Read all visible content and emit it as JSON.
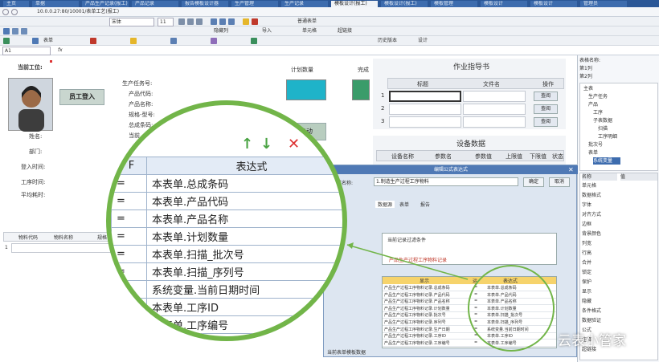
{
  "tabs": [
    "主页",
    "单据",
    "产品生产记录(报工)",
    "产品记录",
    "报告模板设计器",
    "生产管理",
    "生产记录",
    "模板设计(报工)",
    "模板设计(报工)",
    "模板管理",
    "模板设计",
    "模板设计",
    "管理员"
  ],
  "address": "10.0.0.27:80/10001/表单工艺(报工)",
  "toolbar": {
    "font": "宋体",
    "font_size": "11",
    "style_label": "普通表单",
    "btn_hide_col": "隐藏列",
    "btn_import": "导入",
    "btn_cell": "单元格",
    "btn_link": "超链接",
    "btn_form": "表单",
    "btn_history": "历史版本",
    "btn_design": "设计"
  },
  "formula_bar": {
    "cell_ref": "A1",
    "value": ""
  },
  "sheet": {
    "work_order_label": "当前工位:",
    "operator_btn": "员工登入",
    "plan_qty_title": "计划数量",
    "complete_title": "完成",
    "instruction_title": "作业指导书",
    "instruction_headers": [
      "标题",
      "文件名",
      "操作"
    ],
    "instruction_rows": [
      {
        "no": "1",
        "action": "查阅"
      },
      {
        "no": "2",
        "action": "查阅"
      },
      {
        "no": "3",
        "action": "查阅"
      }
    ],
    "equipment_title": "设备数据",
    "equipment_headers": [
      "设备名称",
      "参数名",
      "参数值",
      "上限值",
      "下限值",
      "状态"
    ],
    "fields_mid": [
      "生产任务号:",
      "产品代码:",
      "产品名称:",
      "规格-型号:",
      "总成条码:",
      "当前"
    ],
    "fields_left": [
      "姓名:",
      "部门:",
      "登入时间:",
      "工序时间:",
      "平均耗时:"
    ],
    "start_btn": "启动",
    "bottom_headers": [
      "物料代码",
      "物料名称",
      "规格"
    ],
    "bottom_row_no": "1"
  },
  "right_panel": {
    "top": [
      "表格名称:",
      "第1列",
      "第2列"
    ],
    "tree": [
      "主表",
      "生产任务",
      "产品",
      "工序",
      "子表数据",
      "扫描",
      "工序明细",
      "批次号",
      "表单",
      "系统变量"
    ],
    "prop_headers": [
      "名称",
      "值"
    ],
    "props": [
      "单元格",
      "数据格式",
      "字体",
      "对齐方式",
      "边框",
      "背景颜色",
      "列宽",
      "行高",
      "合并",
      "锁定",
      "保护",
      "显示",
      "隐藏",
      "条件格式",
      "数据验证",
      "公式",
      "注释",
      "超链接"
    ]
  },
  "dialog": {
    "title": "编辑公式表达式",
    "name_label": "公式名称:",
    "name_value": "1.制造生产过程工序物料",
    "ok": "确定",
    "cancel": "取消",
    "tabs": [
      "数据源",
      "表单",
      "报告"
    ],
    "filter_label": "当前记录过滤条件",
    "filter_value": "产品生产过程工序物料记录",
    "table_headers": [
      "显示",
      "运",
      "表达式"
    ],
    "rows": [
      {
        "field": "产品生产过程工序物料记录.总成条码",
        "expr": "本表单.总成条码"
      },
      {
        "field": "产品生产过程工序物料记录.产品代码",
        "expr": "本表单.产品代码"
      },
      {
        "field": "产品生产过程工序物料记录.产品名称",
        "expr": "本表单.产品名称"
      },
      {
        "field": "产品生产过程工序物料记录.计划数量",
        "expr": "本表单.计划数量"
      },
      {
        "field": "产品生产过程工序物料记录.批次号",
        "expr": "本表单.扫描_批次号"
      },
      {
        "field": "产品生产过程工序物料记录.序列号",
        "expr": "本表单.扫描_序列号"
      },
      {
        "field": "产品生产过程工序物料记录.生产日期",
        "expr": "系统变量.当前日期时间"
      },
      {
        "field": "产品生产过程工序物料记录.工序ID",
        "expr": "本表单.工序ID"
      },
      {
        "field": "产品生产过程工序物料记录.工序编号",
        "expr": "本表单.工序编号"
      }
    ],
    "footer": "当前表单模板数据"
  },
  "magnifier": {
    "header_op": "F",
    "header_expr": "表达式",
    "rows": [
      {
        "op": "=",
        "expr": "本表单.总成条码"
      },
      {
        "op": "=",
        "expr": "本表单.产品代码"
      },
      {
        "op": "=",
        "expr": "本表单.产品名称"
      },
      {
        "op": "=",
        "expr": "本表单.计划数量"
      },
      {
        "op": "=",
        "expr": "本表单.扫描_批次号"
      },
      {
        "op": "=",
        "expr": "本表单.扫描_序列号"
      },
      {
        "op": "=",
        "expr": "系统变量.当前日期时间"
      },
      {
        "op": "",
        "expr": "本表单.工序ID"
      },
      {
        "op": "",
        "expr": "本表单.工序编号"
      }
    ]
  },
  "watermark": "云表小管家",
  "colors": {
    "accent": "#2b5797",
    "green": "#72b549",
    "teal": "#1fb3c9",
    "red": "#d33333"
  }
}
